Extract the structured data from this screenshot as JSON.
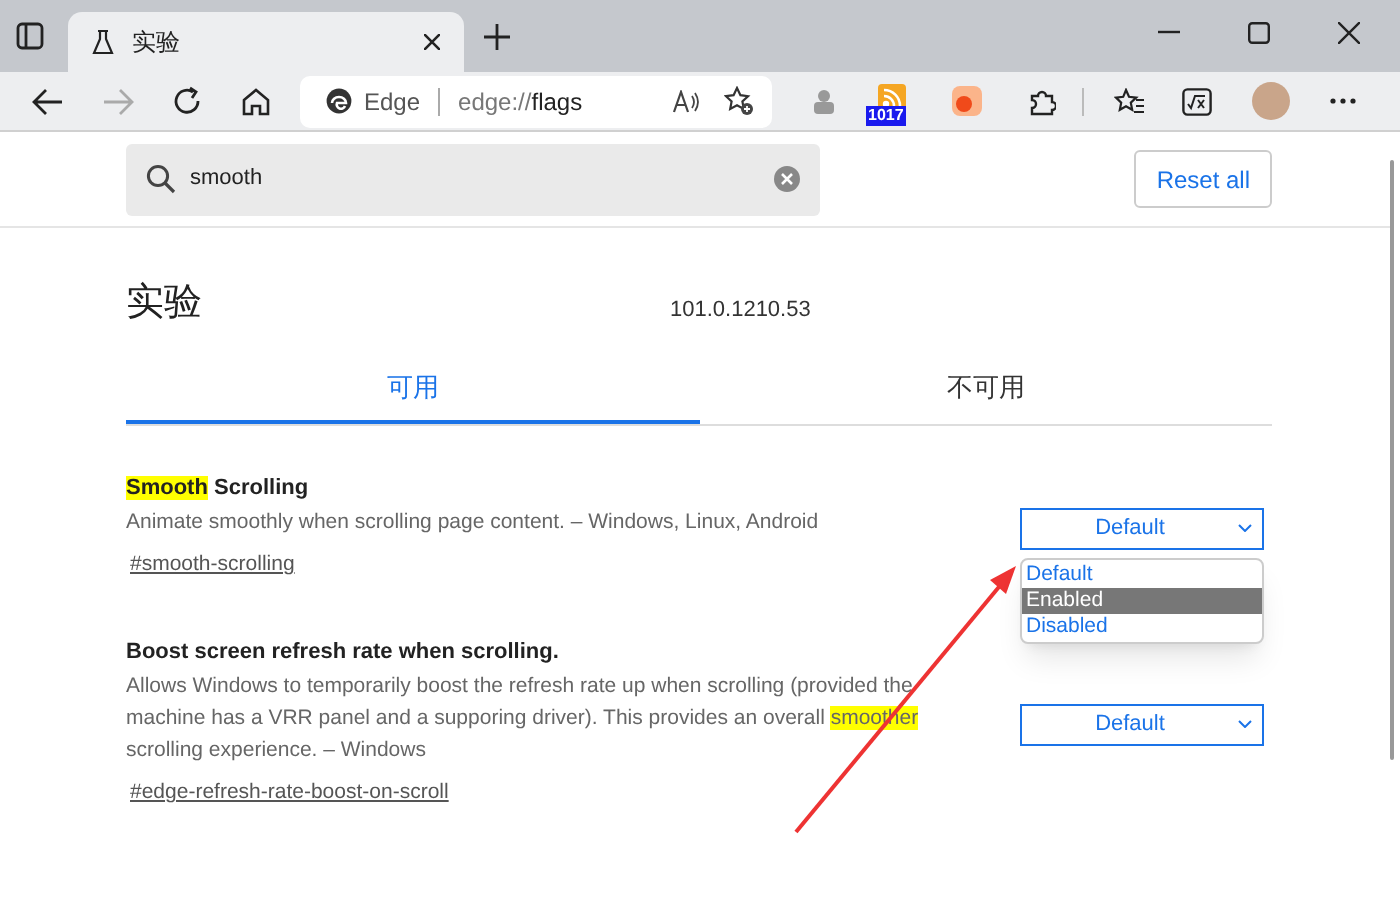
{
  "browser_tabs": [
    {
      "title": "实验",
      "selected": true
    }
  ],
  "address_bar": {
    "site_label": "Edge",
    "url_prefix": "edge://",
    "url_path": "flags"
  },
  "extension_badge": "1017",
  "search": {
    "value": "smooth"
  },
  "reset_button": "Reset all",
  "heading": "实验",
  "version": "101.0.1210.53",
  "content_tabs": [
    {
      "label": "可用",
      "selected": true
    },
    {
      "label": "不可用",
      "selected": false
    }
  ],
  "experiments": [
    {
      "title": [
        {
          "text": "Smooth",
          "highlighted": true
        },
        {
          "text": " Scrolling",
          "highlighted": false
        }
      ],
      "description": [
        {
          "text": "Animate smoothly when scrolling page content. – Windows, Linux, Android",
          "highlighted": false
        }
      ],
      "link": "#smooth-scrolling",
      "select": {
        "value": "Default",
        "expanded": true,
        "options": [
          {
            "label": "Default",
            "highlighted": false
          },
          {
            "label": "Enabled",
            "highlighted": true
          },
          {
            "label": "Disabled",
            "highlighted": false
          }
        ]
      }
    },
    {
      "title": [
        {
          "text": "Boost screen refresh rate when scrolling.",
          "highlighted": false
        }
      ],
      "description": [
        {
          "text": "Allows Windows to temporarily boost the refresh rate up when scrolling (provided the machine has a VRR panel and a supporing driver). This provides an overall ",
          "highlighted": false
        },
        {
          "text": "smoother",
          "highlighted": true
        },
        {
          "text": " scrolling experience. – Windows",
          "highlighted": false
        }
      ],
      "link": "#edge-refresh-rate-boost-on-scroll",
      "select": {
        "value": "Default",
        "expanded": false
      }
    }
  ]
}
